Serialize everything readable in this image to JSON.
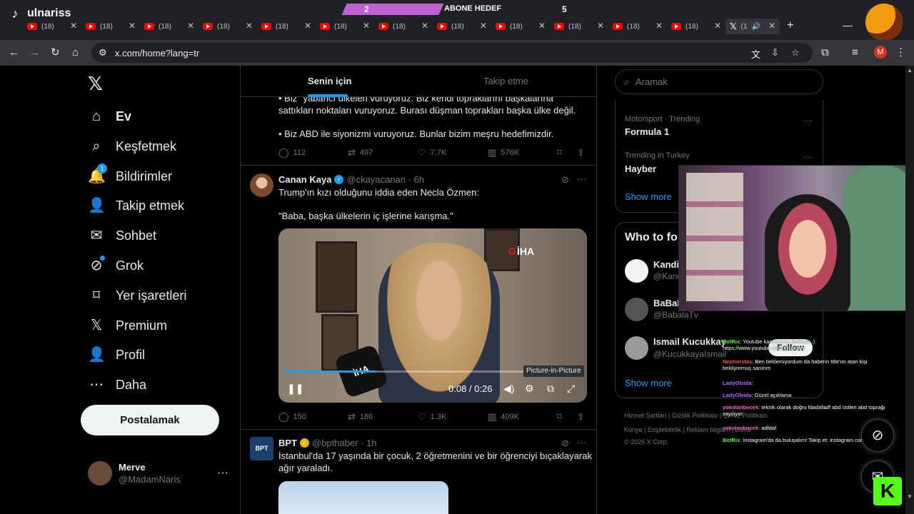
{
  "stream": {
    "streamer_name": "ulnariss",
    "goal_current": "2",
    "goal_label": "ABONE HEDEF",
    "goal_target": "5",
    "goal_progress": 0.4
  },
  "browser": {
    "tab_title": "(18) ",
    "tabs_visible": 12,
    "active_tab_title": "(1",
    "url": "x.com/home?lang=tr",
    "profile_initial": "M"
  },
  "nav": {
    "items": [
      {
        "label": "Ev",
        "icon": "home-icon"
      },
      {
        "label": "Keşfetmek",
        "icon": "search-icon"
      },
      {
        "label": "Bildirimler",
        "icon": "bell-icon",
        "badge": "1"
      },
      {
        "label": "Takip etmek",
        "icon": "add-person-icon"
      },
      {
        "label": "Sohbet",
        "icon": "mail-icon"
      },
      {
        "label": "Grok",
        "icon": "grok-icon"
      },
      {
        "label": "Yer işaretleri",
        "icon": "bookmark-icon"
      },
      {
        "label": "Premium",
        "icon": "x-icon"
      },
      {
        "label": "Profil",
        "icon": "person-icon"
      },
      {
        "label": "Daha",
        "icon": "more-circle-icon"
      }
    ],
    "post_button": "Postalamak",
    "user_name": "Merve",
    "user_handle": "@MadamNaris"
  },
  "feed": {
    "tab_for_you": "Senin için",
    "tab_following": "Takip etme",
    "post0": {
      "line1": "• Biz \"yabancı ülkeleri vuruyoruz. Biz kendi topraklarını başkalarına",
      "line2": "sattıkları noktaları vuruyoruz. Burası düşman toprakları başka ülke değil.",
      "line3": "• Biz ABD ile siyonizmi vuruyoruz. Bunlar bizim meşru hedefimizdir.",
      "replies": "112",
      "reposts": "497",
      "likes": "7.7K",
      "views": "576K"
    },
    "post1": {
      "name": "Canan Kaya",
      "handle": "@ckayacanan · 6h",
      "text1": "Trump'ın kızı olduğunu iddia eden Necla Özmen:",
      "text2": "\"Baba, başka ülkelerin iç işlerine karışma.\"",
      "video_time": "0:08 / 0:26",
      "video_progress": 0.31,
      "video_watermark": "İHA",
      "tooltip": "Picture-in-Picture",
      "replies": "150",
      "reposts": "186",
      "likes": "1.3K",
      "views": "409K"
    },
    "post2": {
      "name": "BPT",
      "handle": "@bpthaber · 1h",
      "avatar_text": "BPT",
      "text1": "İstanbul'da 17 yaşında bir çocuk, 2 öğretmenini ve bir öğrenciyi bıçaklayarak",
      "text2": "ağır yaraladı."
    }
  },
  "right": {
    "search_placeholder": "Aramak",
    "trends": [
      {
        "category": "Motorsport · Trending",
        "name": "Formula 1"
      },
      {
        "category": "Trending in Turkey",
        "name": "Hayber"
      }
    ],
    "show_more": "Show more",
    "who_to_follow_title": "Who to fo",
    "suggestions": [
      {
        "name": "Kandi",
        "handle": "@Kand"
      },
      {
        "name": "BaBal",
        "handle": "@BabalaTv"
      },
      {
        "name": "Ismail Kucukkay",
        "handle": "@KucukkayaIsmail"
      }
    ],
    "follow_label": "Follow",
    "show_more2": "Show more",
    "footer1": "Hizmet Şartları  |  Gizlilik Politikası  |  Çerez Politikası",
    "footer2": "Künye  |  Erişilebilirlik  |  Reklam bilgileri  |  Daha",
    "footer3": "© 2026 X Corp."
  },
  "chat": [
    {
      "user": "BotRix",
      "color": "#53fc18",
      "text": ": Youtube kanalımıza Bekleriz :) https://www.youtube.com/@ulnaris"
    },
    {
      "user": "Nephorstas",
      "color": "#ff4d4d",
      "text": ": Ben beklemiyordum da haberin title'ını atan kişi bekliyormuş sanırım"
    },
    {
      "user": "LadyOlvida",
      "color": "#b266ff",
      "text": ":"
    },
    {
      "user": "LadyOlvida",
      "color": "#b266ff",
      "text": ": Güzel açıklama"
    },
    {
      "user": "yokolanbocek",
      "color": "#ff5ec4",
      "text": ": teknik olarak doğru fdadafadf abd üstleri abd toprağı sayılıyor"
    },
    {
      "user": "yokolanbocek",
      "color": "#ff5ec4",
      "text": ": adfdaf"
    },
    {
      "user": "BotRix",
      "color": "#53fc18",
      "text": ": Instagram'da da buluşalım! Takip et: instagram.com/ulnariss"
    }
  ],
  "colors": {
    "accent": "#1d9bf0",
    "background": "#000000",
    "border": "#2f3336",
    "muted": "#71767b",
    "kick_green": "#53fc18"
  }
}
